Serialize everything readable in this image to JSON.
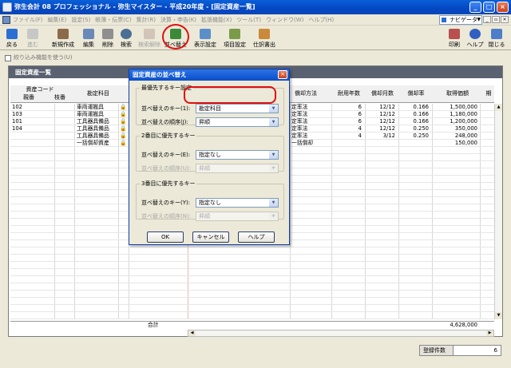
{
  "window": {
    "title": "弥生会計 08 プロフェッショナル - 弥生マイスター - 平成20年度 - [固定資産一覧]"
  },
  "menu": {
    "items": [
      "ファイル(F)",
      "編集(E)",
      "設定(S)",
      "帳簿・伝票(C)",
      "集計(R)",
      "決算・申告(K)",
      "拡張機能(X)",
      "ツール(T)",
      "ウィンドウ(W)",
      "ヘルプ(H)"
    ],
    "navigator": "ナビゲータ"
  },
  "toolbar": {
    "back": "戻る",
    "forward": "進む",
    "new": "新規作成",
    "edit": "編集",
    "delete": "削除",
    "search": "検索",
    "cancel_search": "検索解除",
    "sort": "並べ替え",
    "display_settings": "表示設定",
    "item_settings": "項目設定",
    "journal": "仕訳書出",
    "print": "印刷",
    "help": "ヘルプ",
    "close": "閉じる"
  },
  "filter_label": "絞り込み機能を使う(U)",
  "panel": {
    "title": "固定資産一覧"
  },
  "table": {
    "headers": {
      "asset_code": "資産コード",
      "parent": "親番",
      "branch": "枝番",
      "account": "勘定科目",
      "method": "償却方法",
      "life": "耐用年数",
      "months": "償却月数",
      "rate": "償却率",
      "cost": "取得価額",
      "extra": "期"
    },
    "rows": [
      {
        "code": "102",
        "account": "車両運搬具",
        "method": "定率法",
        "life": "6",
        "months": "12/12",
        "rate": "0.166",
        "cost": "1,500,000"
      },
      {
        "code": "103",
        "account": "車両運搬具",
        "method": "定率法",
        "life": "6",
        "months": "12/12",
        "rate": "0.166",
        "cost": "1,180,000"
      },
      {
        "code": "101",
        "account": "工具器具備品",
        "method": "定率法",
        "life": "6",
        "months": "12/12",
        "rate": "0.166",
        "cost": "1,200,000"
      },
      {
        "code": "104",
        "account": "工具器具備品",
        "method": "定率法",
        "life": "4",
        "months": "12/12",
        "rate": "0.250",
        "cost": "350,000"
      },
      {
        "code": "",
        "account": "工具器具備品",
        "method": "定率法",
        "life": "4",
        "months": "3/12",
        "rate": "0.250",
        "cost": "248,000"
      },
      {
        "code": "",
        "account": "一括償却資産",
        "method": "一括償却",
        "life": "",
        "months": "",
        "rate": "",
        "cost": "150,000"
      }
    ],
    "total_label": "合計",
    "total_value": "4,628,000"
  },
  "status": {
    "label": "登録件数",
    "value": "6"
  },
  "dialog": {
    "title": "固定資産の並べ替え",
    "group1": {
      "legend": "最優先するキー設定",
      "key_label": "並べ替えのキー(1):",
      "key_value": "勘定科目",
      "order_label": "並べ替えの順序(J):",
      "order_value": "昇順"
    },
    "group2": {
      "legend": "2番目に優先するキー",
      "key_label": "並べ替えのキー(E):",
      "key_value": "指定なし",
      "order_label": "並べ替えの順序(U):",
      "order_value": "昇順"
    },
    "group3": {
      "legend": "3番目に優先するキー",
      "key_label": "並べ替えのキー(Y):",
      "key_value": "指定なし",
      "order_label": "並べ替えの順序(N):",
      "order_value": "昇順"
    },
    "ok": "OK",
    "cancel": "キャンセル",
    "help": "ヘルプ"
  }
}
